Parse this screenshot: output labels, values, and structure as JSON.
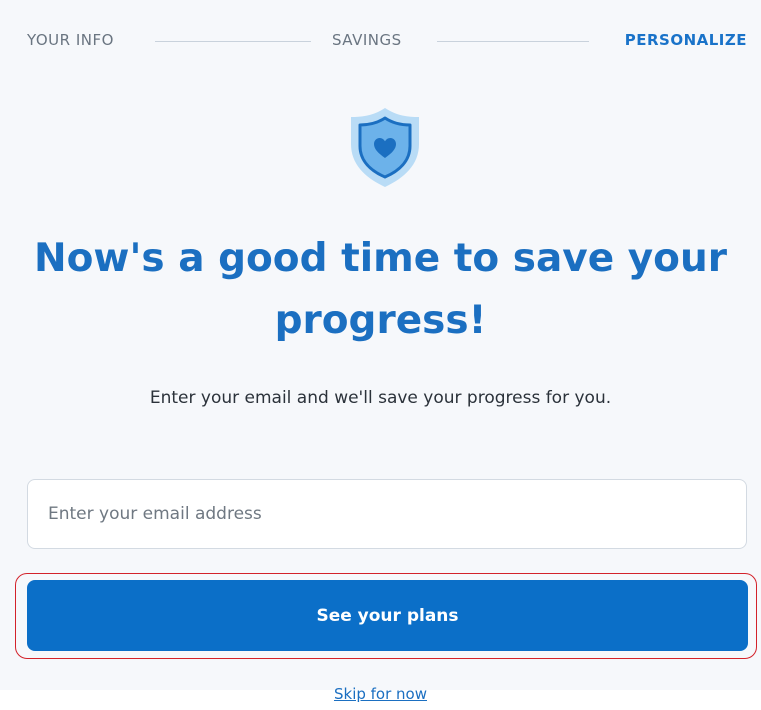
{
  "stepper": {
    "steps": [
      {
        "label": "YOUR INFO",
        "active": false
      },
      {
        "label": "SAVINGS",
        "active": false
      },
      {
        "label": "PERSONALIZE",
        "active": true
      }
    ]
  },
  "hero": {
    "icon": "shield-heart-icon",
    "headline": "Now's a good time to save your progress!",
    "subtext": "Enter your email and we'll save your progress for you."
  },
  "form": {
    "email_value": "",
    "email_placeholder": "Enter your email address",
    "cta_label": "See your plans",
    "skip_label": "Skip for now"
  },
  "colors": {
    "brand_blue": "#0b6fc8",
    "heading_blue": "#1b6fc1",
    "highlight_red": "#d3222a"
  }
}
